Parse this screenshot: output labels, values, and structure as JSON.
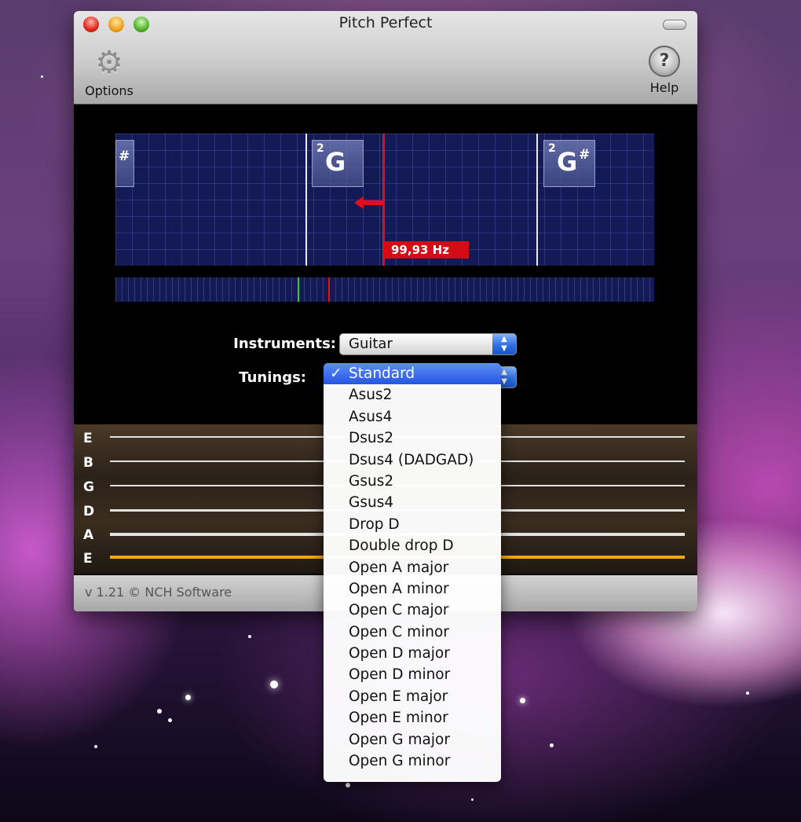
{
  "window": {
    "title": "Pitch Perfect"
  },
  "toolbar": {
    "options_label": "Options",
    "help_label": "Help"
  },
  "tuner": {
    "left_note_sharp": "#",
    "center_note": {
      "octave": "2",
      "letter": "G"
    },
    "right_note": {
      "octave": "2",
      "letter": "G",
      "accidental": "#"
    },
    "frequency": "99,93 Hz"
  },
  "controls": {
    "instruments_label": "Instruments:",
    "instrument_value": "Guitar",
    "tunings_label": "Tunings:"
  },
  "strings": [
    "E",
    "B",
    "G",
    "D",
    "A",
    "E"
  ],
  "status": {
    "version": "v 1.21 © NCH Software"
  },
  "tunings_menu": {
    "check": "✓",
    "items": [
      "Standard",
      "Asus2",
      "Asus4",
      "Dsus2",
      "Dsus4 (DADGAD)",
      "Gsus2",
      "Gsus4",
      "Drop D",
      "Double drop D",
      "Open A major",
      "Open A minor",
      "Open C major",
      "Open C minor",
      "Open D major",
      "Open D minor",
      "Open E major",
      "Open E minor",
      "Open G major",
      "Open G minor"
    ]
  },
  "colors": {
    "needle": "#e0101a",
    "low_e_string": "#f2a80f",
    "menu_selection": "#2556e2"
  }
}
